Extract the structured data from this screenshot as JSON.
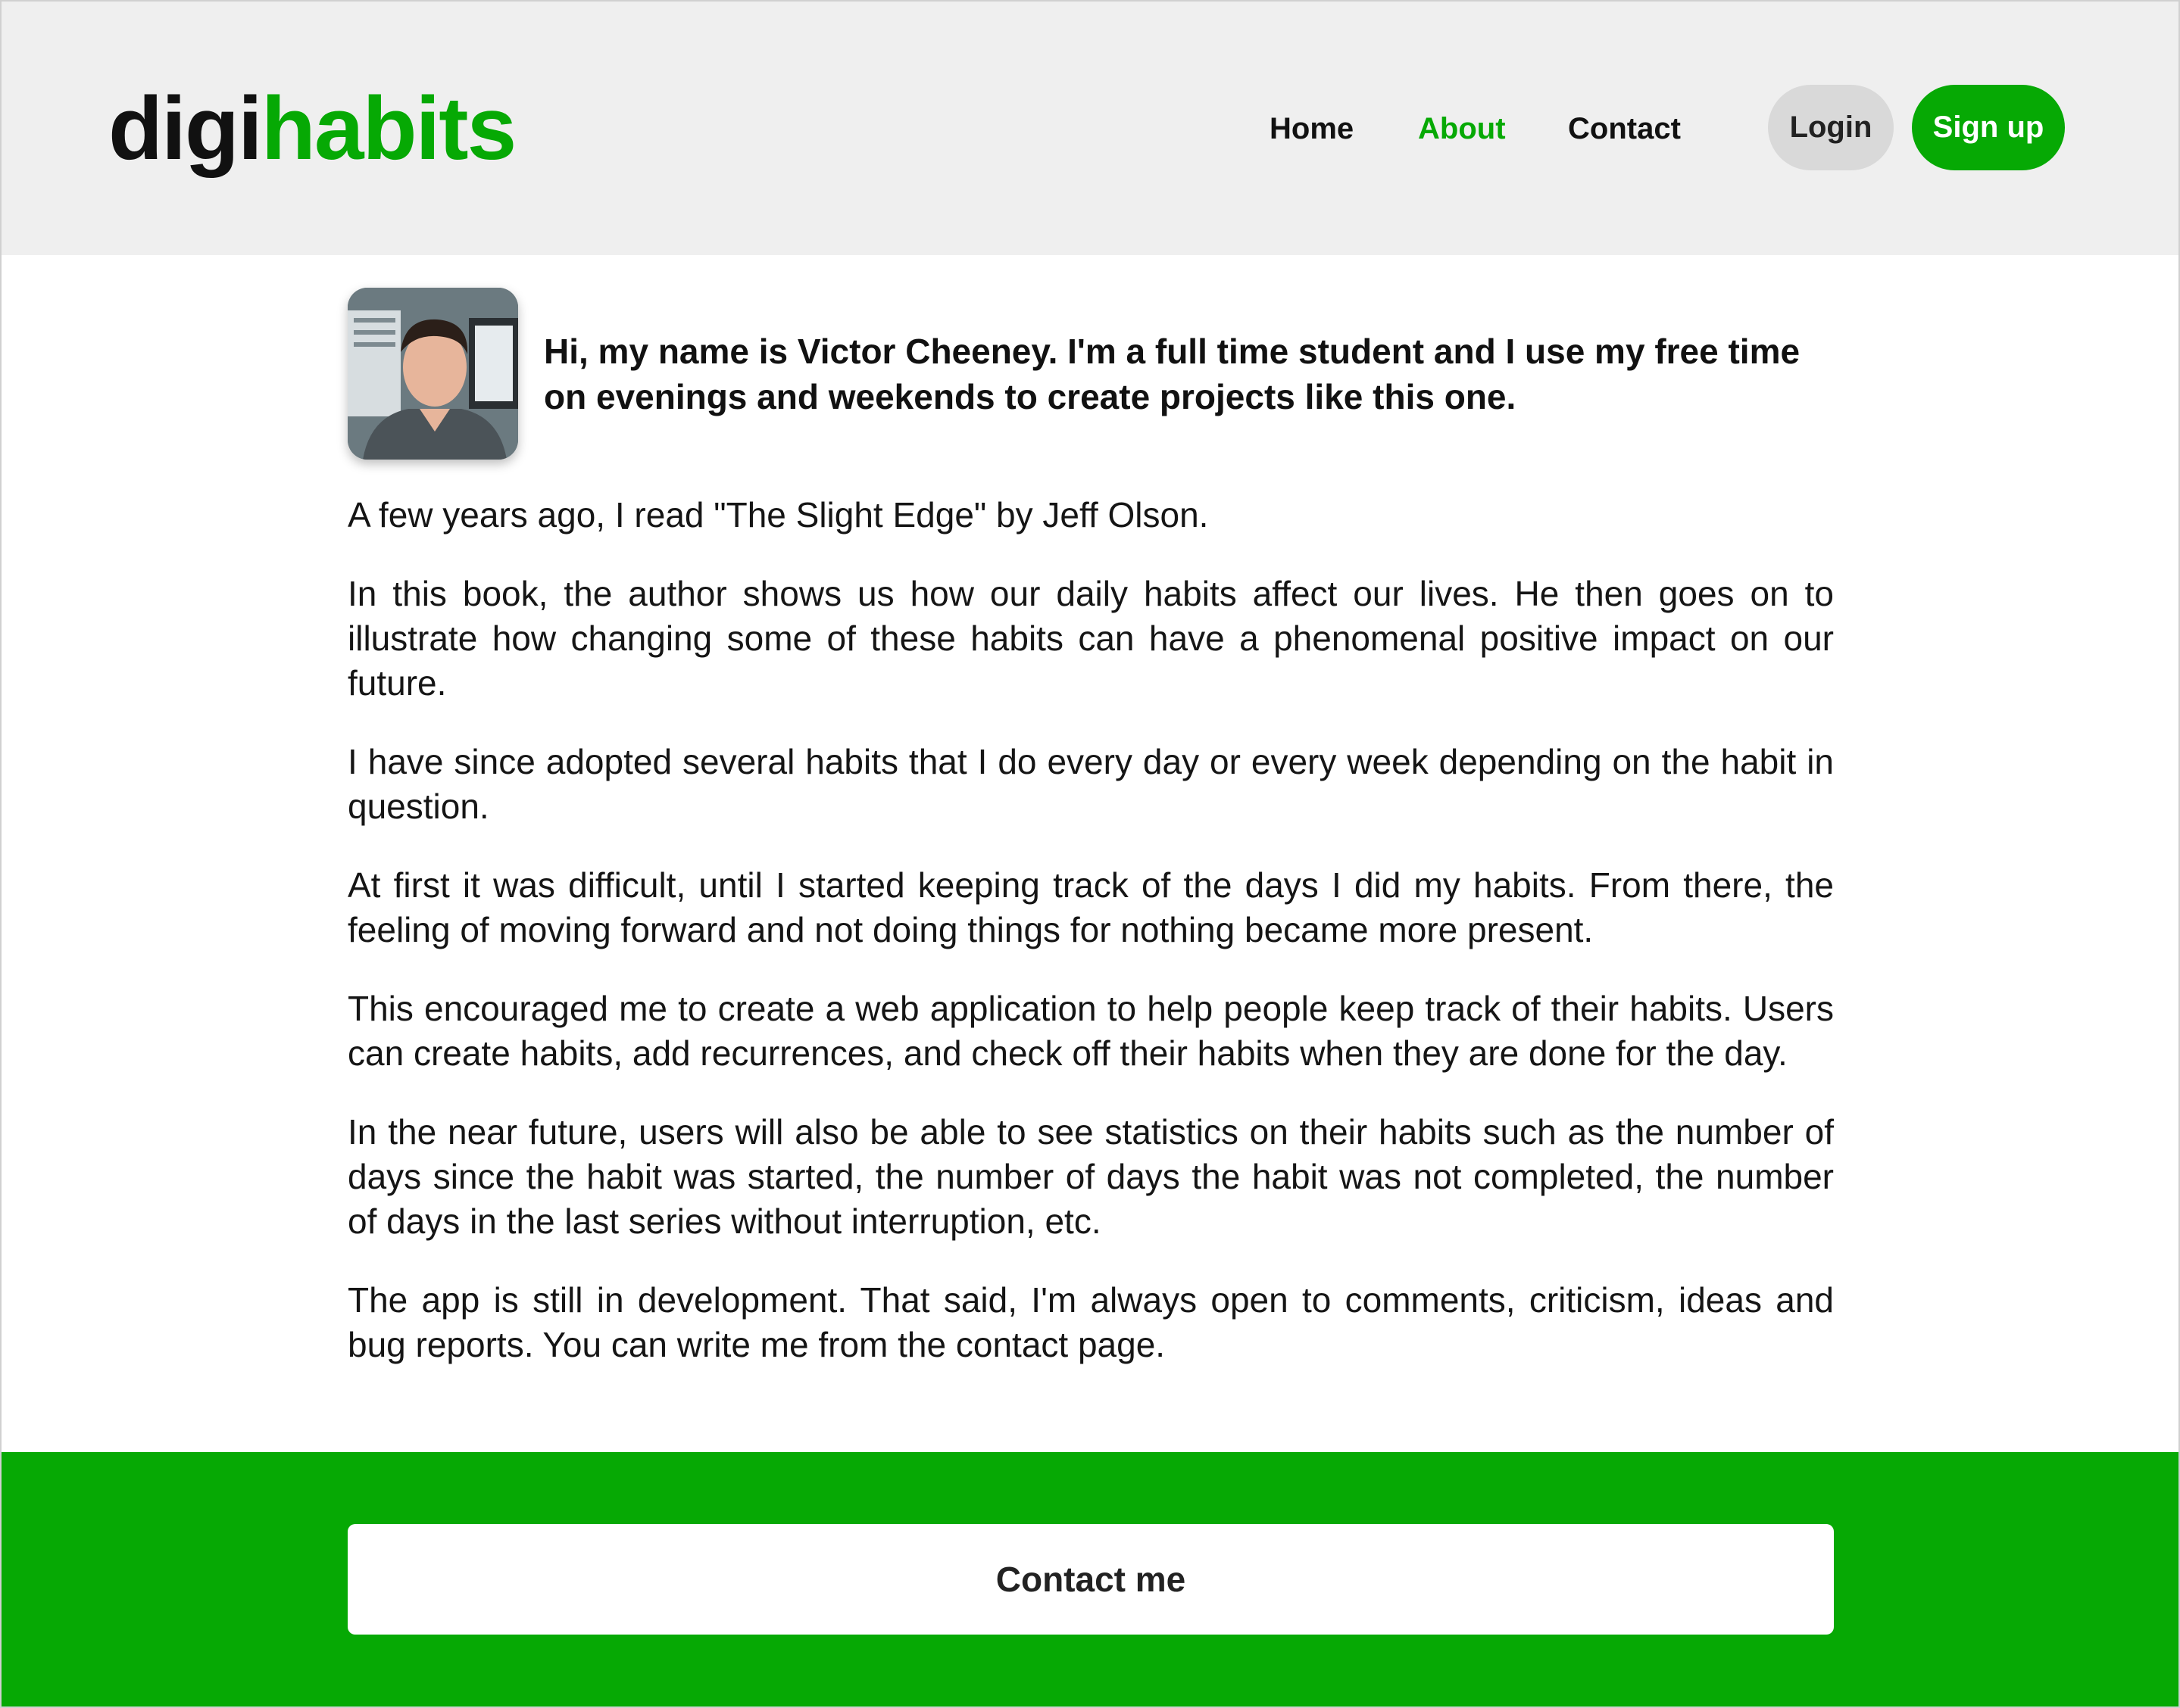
{
  "brand": {
    "part1": "digi",
    "part2": "habits",
    "accent": "#06a904"
  },
  "nav": {
    "items": [
      {
        "label": "Home",
        "active": false
      },
      {
        "label": "About",
        "active": true
      },
      {
        "label": "Contact",
        "active": false
      }
    ],
    "login_label": "Login",
    "signup_label": "Sign up"
  },
  "about": {
    "intro": "Hi, my name is Victor Cheeney. I'm a full time student and I use my free time on evenings and weekends to create projects like this one.",
    "paragraphs": [
      "A few years ago, I read \"The Slight Edge\" by Jeff Olson.",
      "In this book, the author shows us how our daily habits affect our lives. He then goes on to illustrate how changing some of these habits can have a phenomenal positive impact on our future.",
      "I have since adopted several habits that I do every day or every week depending on the habit in question.",
      "At first it was difficult, until I started keeping track of the days I did my habits. From there, the feeling of moving forward and not doing things for nothing became more present.",
      "This encouraged me to create a web application to help people keep track of their habits. Users can create habits, add recurrences, and check off their habits when they are done for the day.",
      "In the near future, users will also be able to see statistics on their habits such as the number of days since the habit was started, the number of days the habit was not completed, the number of days in the last series without interruption, etc.",
      "The app is still in development. That said, I'm always open to comments, criticism, ideas and bug reports. You can write me from the contact page."
    ]
  },
  "footer": {
    "contact_label": "Contact me"
  }
}
